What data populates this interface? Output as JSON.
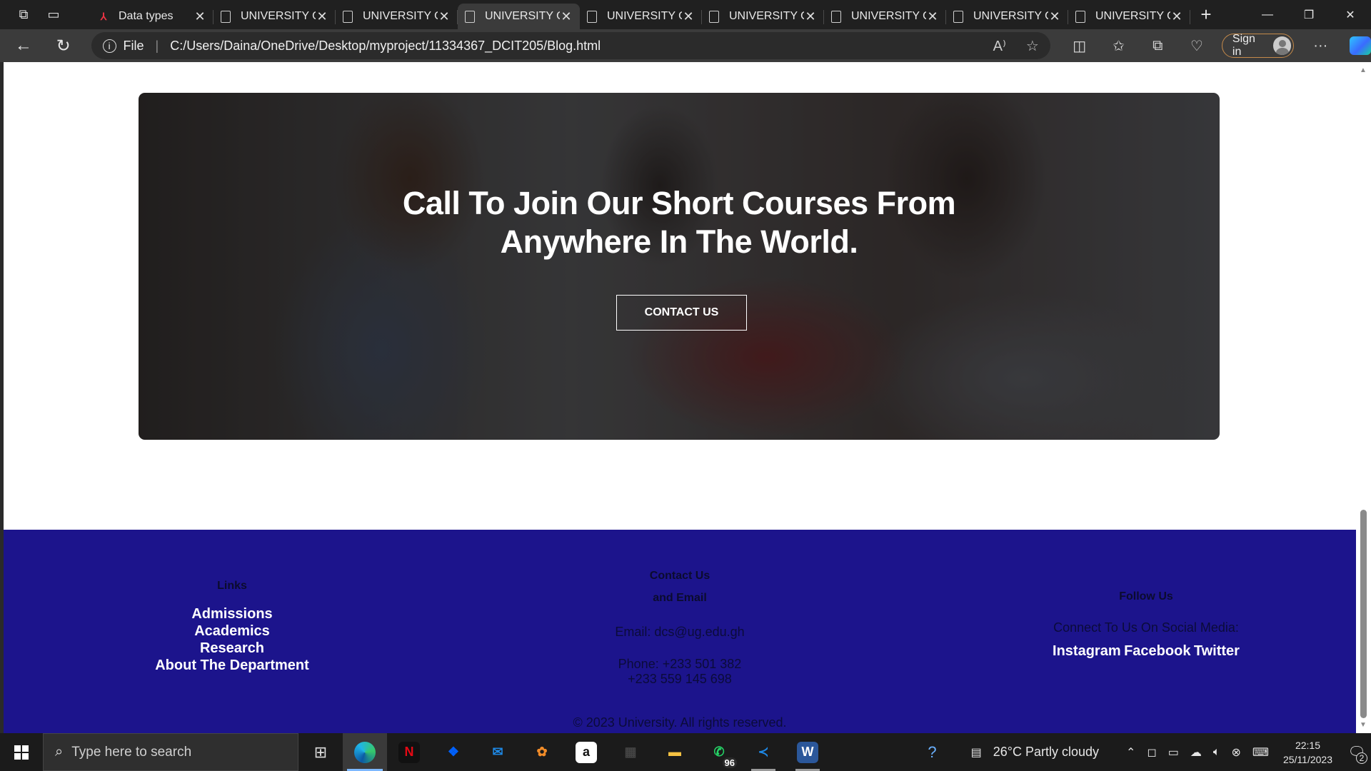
{
  "browser": {
    "tabs": [
      {
        "title": "Data types",
        "icon": "pdf-red-icon",
        "active": false
      },
      {
        "title": "UNIVERSITY OF",
        "icon": "page-icon",
        "active": false
      },
      {
        "title": "UNIVERSITY OF",
        "icon": "page-icon",
        "active": false
      },
      {
        "title": "UNIVERSITY OF",
        "icon": "page-icon",
        "active": true
      },
      {
        "title": "UNIVERSITY OF",
        "icon": "page-icon",
        "active": false
      },
      {
        "title": "UNIVERSITY OF",
        "icon": "page-icon",
        "active": false
      },
      {
        "title": "UNIVERSITY OF",
        "icon": "page-icon",
        "active": false
      },
      {
        "title": "UNIVERSITY OF",
        "icon": "page-icon",
        "active": false
      },
      {
        "title": "UNIVERSITY OF",
        "icon": "page-icon",
        "active": false
      }
    ],
    "address": {
      "scheme_label": "File",
      "url": "C:/Users/Daina/OneDrive/Desktop/myproject/11334367_DCIT205/Blog.html"
    },
    "signin_label": "Sign in"
  },
  "page": {
    "hero": {
      "title_line1": "Call To Join Our Short Courses From",
      "title_line2": "Anywhere In The World.",
      "button_label": "CONTACT US"
    },
    "footer": {
      "links": {
        "heading": "Links",
        "items": [
          "Admissions",
          "Academics",
          "Research",
          "About The Department"
        ]
      },
      "contact": {
        "heading_line1": "Contact Us",
        "heading_line2": "and Email",
        "email": "Email: dcs@ug.edu.gh",
        "phone1": "Phone: +233 501 382",
        "phone2": "+233 559 145 698"
      },
      "follow": {
        "heading": "Follow Us",
        "subtitle": "Connect To Us On Social Media:",
        "networks": [
          "Instagram",
          "Facebook",
          "Twitter"
        ]
      },
      "copyright": "© 2023 University. All rights reserved."
    }
  },
  "taskbar": {
    "search_placeholder": "Type here to search",
    "apps": [
      {
        "name": "edge",
        "active": true
      },
      {
        "name": "netflix",
        "letter": "N",
        "color": "#e50914"
      },
      {
        "name": "dropbox",
        "letter": "❖",
        "color": "#0061fe"
      },
      {
        "name": "mail",
        "letter": "✉",
        "color": "#1e88e5"
      },
      {
        "name": "fl-studio",
        "letter": "✿",
        "color": "#f28c28"
      },
      {
        "name": "amazon",
        "letter": "a",
        "color": "#ffffff"
      },
      {
        "name": "ms-store",
        "letter": "▦",
        "color": "#444"
      },
      {
        "name": "file-explorer",
        "letter": "▬",
        "color": "#f5c242"
      },
      {
        "name": "whatsapp",
        "letter": "✆",
        "color": "#25d366",
        "badge": "96"
      },
      {
        "name": "vscode",
        "letter": "≺",
        "color": "#1e88e5",
        "running": true
      },
      {
        "name": "word",
        "letter": "W",
        "color": "#2b579a",
        "running": true
      }
    ],
    "weather": "26°C  Partly cloudy",
    "time": "22:15",
    "date": "25/11/2023",
    "notification_count": "2"
  }
}
